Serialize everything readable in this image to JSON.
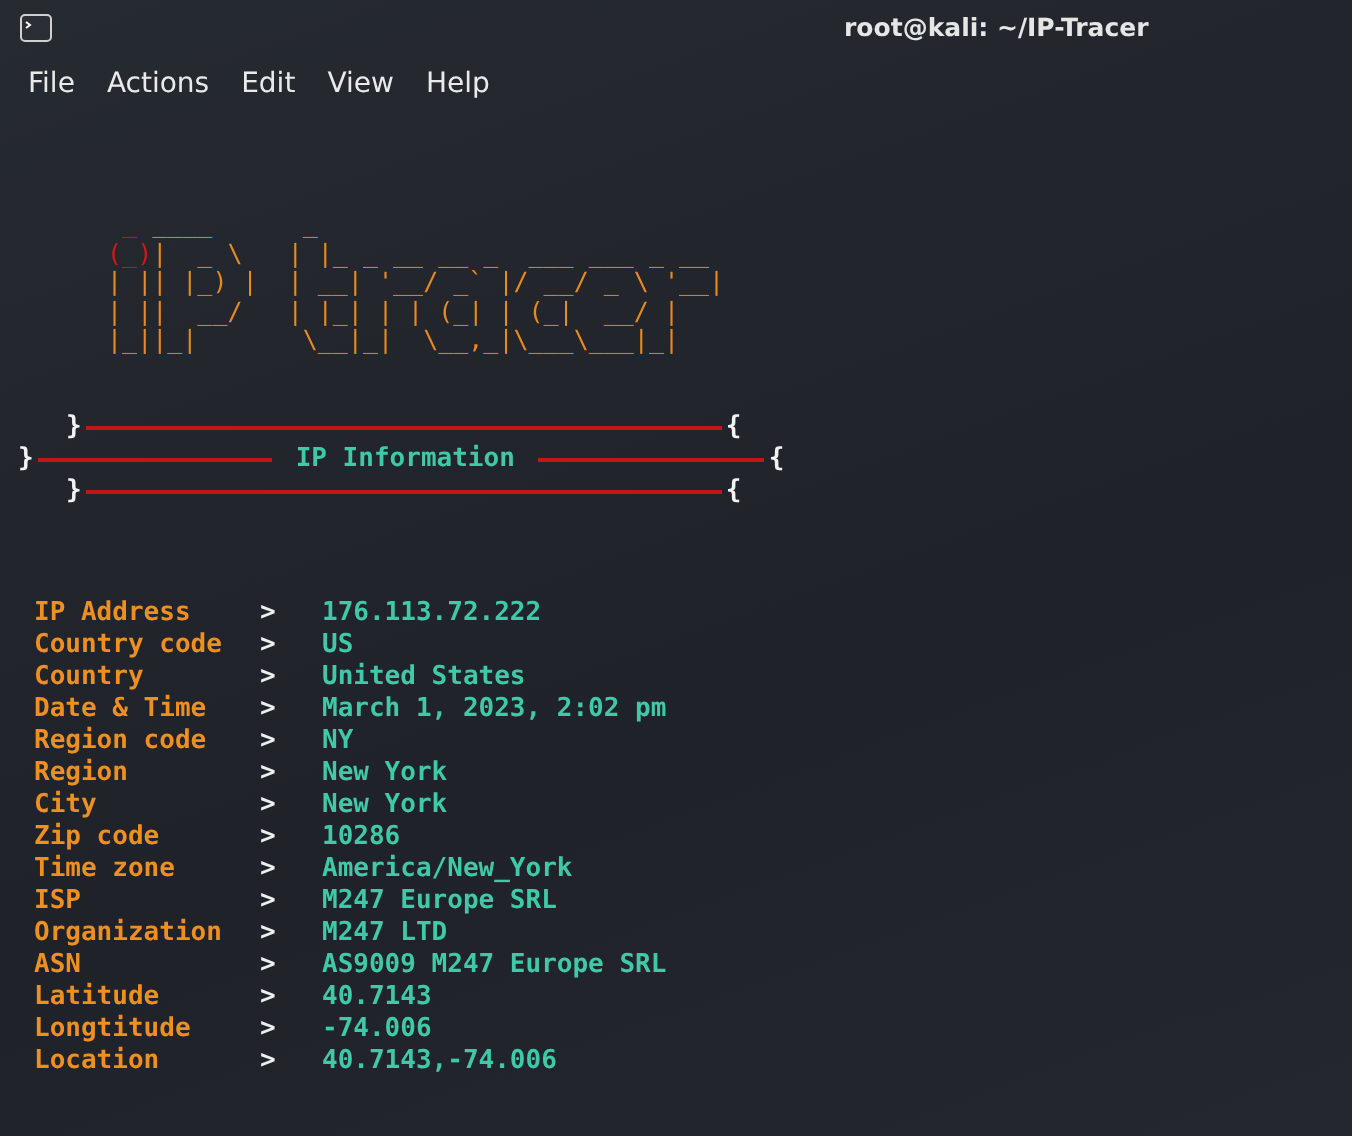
{
  "window": {
    "title": "root@kali: ~/IP-Tracer"
  },
  "menu": [
    "File",
    "Actions",
    "Edit",
    "View",
    "Help"
  ],
  "ascii_art": [
    [
      {
        "kind": "accent",
        "text": "  _ "
      },
      {
        "kind": "main",
        "text": "____      _"
      }
    ],
    [
      {
        "kind": "accent",
        "text": " (_)"
      },
      {
        "kind": "main",
        "text": "|  _ \\   | |_ _ __ __ _  ___ ___ _ __ "
      }
    ],
    [
      {
        "kind": "main",
        "text": " | || |_) |  | __| '__/ _` |/ __/ _ \\ '__|"
      }
    ],
    [
      {
        "kind": "main",
        "text": " | ||  __/   | |_| | | (_| | (_|  __/ |   "
      }
    ],
    [
      {
        "kind": "main",
        "text": " |_||_|       \\__|_|  \\__,_|\\___\\___|_|   "
      }
    ]
  ],
  "banner": {
    "open": "}",
    "close": "{",
    "title": "IP Information"
  },
  "separator": ">",
  "rows": [
    {
      "label": "IP Address",
      "value": "176.113.72.222"
    },
    {
      "label": "Country code",
      "value": "US"
    },
    {
      "label": "Country",
      "value": "United States"
    },
    {
      "label": "Date & Time",
      "value": "March 1, 2023, 2:02 pm"
    },
    {
      "label": "Region code",
      "value": "NY"
    },
    {
      "label": "Region",
      "value": "New York"
    },
    {
      "label": "City",
      "value": "New York"
    },
    {
      "label": "Zip code",
      "value": "10286"
    },
    {
      "label": "Time zone",
      "value": "America/New_York"
    },
    {
      "label": "ISP",
      "value": "M247 Europe SRL"
    },
    {
      "label": "Organization",
      "value": "M247 LTD"
    },
    {
      "label": "ASN",
      "value": "AS9009 M247 Europe SRL"
    },
    {
      "label": "Latitude",
      "value": "40.7143"
    },
    {
      "label": "Longtitude",
      "value": "-74.006"
    },
    {
      "label": "Location",
      "value": "40.7143,-74.006"
    }
  ]
}
